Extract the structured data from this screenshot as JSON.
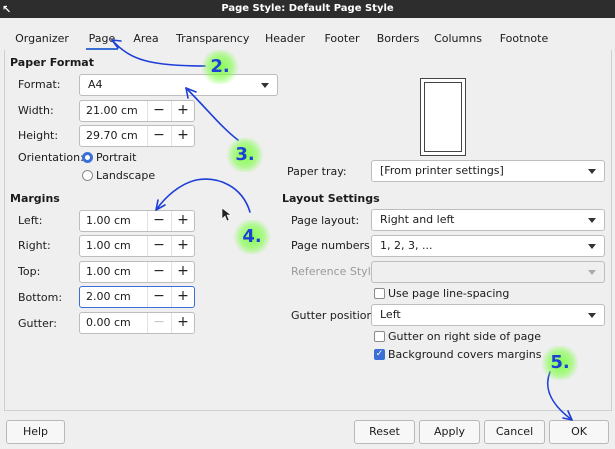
{
  "window": {
    "title": "Page Style: Default Page Style"
  },
  "tabs": [
    {
      "label": "Organizer"
    },
    {
      "label": "Page"
    },
    {
      "label": "Area"
    },
    {
      "label": "Transparency"
    },
    {
      "label": "Header"
    },
    {
      "label": "Footer"
    },
    {
      "label": "Borders"
    },
    {
      "label": "Columns"
    },
    {
      "label": "Footnote"
    }
  ],
  "active_tab": "Page",
  "paper_format": {
    "heading": "Paper Format",
    "format_label": "Format:",
    "format_value": "A4",
    "width_label": "Width:",
    "width_value": "21.00 cm",
    "height_label": "Height:",
    "height_value": "29.70 cm",
    "orientation_label": "Orientation:",
    "portrait_label": "Portrait",
    "landscape_label": "Landscape",
    "orientation_selected": "Portrait"
  },
  "margins": {
    "heading": "Margins",
    "left_label": "Left:",
    "left_value": "1.00 cm",
    "right_label": "Right:",
    "right_value": "1.00 cm",
    "top_label": "Top:",
    "top_value": "1.00 cm",
    "bottom_label": "Bottom:",
    "bottom_value": "2.00 cm",
    "gutter_label": "Gutter:",
    "gutter_value": "0.00 cm"
  },
  "paper_tray": {
    "label": "Paper tray:",
    "value": "[From printer settings]"
  },
  "layout": {
    "heading": "Layout Settings",
    "page_layout_label": "Page layout:",
    "page_layout_value": "Right and left",
    "page_numbers_label": "Page numbers:",
    "page_numbers_value": "1, 2, 3, ...",
    "reference_style_label": "Reference Style:",
    "reference_style_value": "",
    "line_spacing_label": "Use page line-spacing",
    "line_spacing_checked": false,
    "gutter_position_label": "Gutter position:",
    "gutter_position_value": "Left",
    "gutter_right_label": "Gutter on right side of page",
    "gutter_right_checked": false,
    "bg_covers_label": "Background covers margins",
    "bg_covers_checked": true
  },
  "buttons": {
    "help": "Help",
    "reset": "Reset",
    "apply": "Apply",
    "cancel": "Cancel",
    "ok": "OK"
  },
  "annotations": {
    "a2": "2.",
    "a3": "3.",
    "a4": "4.",
    "a5": "5."
  },
  "colors": {
    "accent": "#3b6fd6",
    "annotation_ink": "#1e3fd8",
    "annotation_glow": "#78ff3c"
  }
}
